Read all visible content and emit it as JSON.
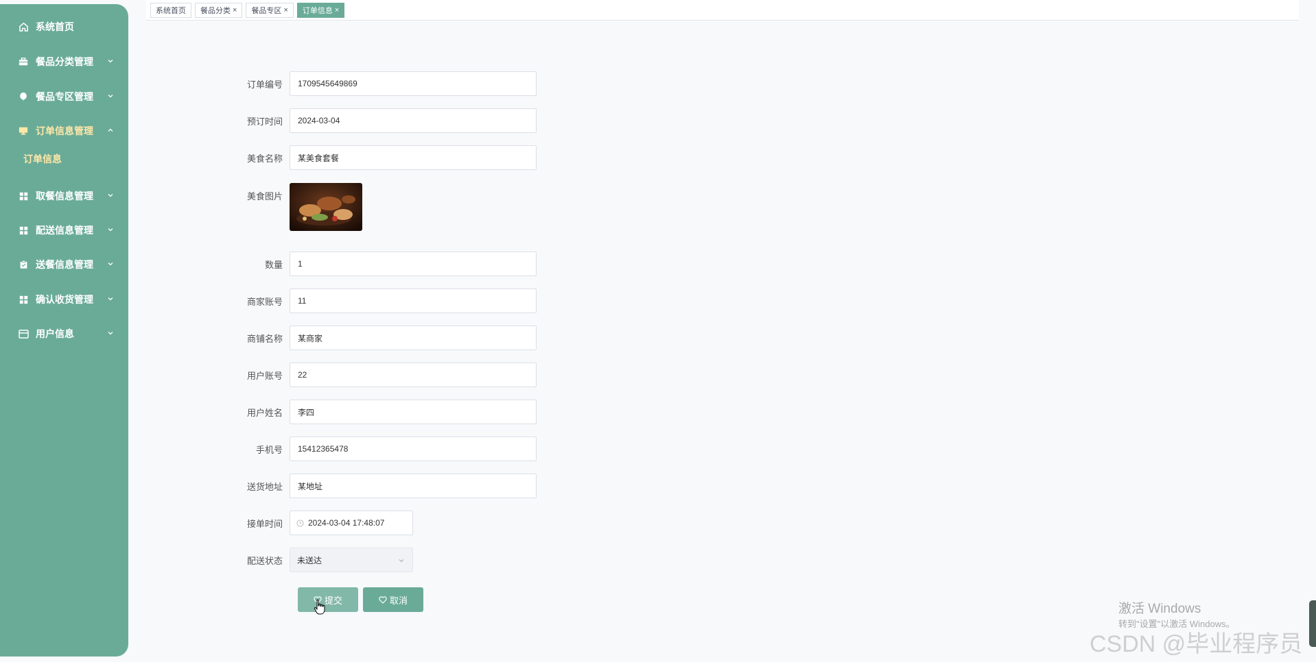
{
  "sidebar": {
    "items": [
      {
        "label": "系统首页",
        "icon": "home-icon",
        "expandable": false
      },
      {
        "label": "餐品分类管理",
        "icon": "briefcase-icon",
        "expandable": true
      },
      {
        "label": "餐品专区管理",
        "icon": "balloon-icon",
        "expandable": true
      },
      {
        "label": "订单信息管理",
        "icon": "monitor-icon",
        "expandable": true,
        "expanded": true
      },
      {
        "label": "取餐信息管理",
        "icon": "grid-icon",
        "expandable": true
      },
      {
        "label": "配送信息管理",
        "icon": "grid-icon",
        "expandable": true
      },
      {
        "label": "送餐信息管理",
        "icon": "clipboard-icon",
        "expandable": true
      },
      {
        "label": "确认收货管理",
        "icon": "grid-icon",
        "expandable": true
      },
      {
        "label": "用户信息",
        "icon": "card-icon",
        "expandable": true
      }
    ],
    "submenu": {
      "label": "订单信息"
    }
  },
  "tabs": [
    {
      "label": "系统首页",
      "closable": false,
      "active": false
    },
    {
      "label": "餐品分类",
      "closable": true,
      "active": false
    },
    {
      "label": "餐品专区",
      "closable": true,
      "active": false
    },
    {
      "label": "订单信息",
      "closable": true,
      "active": true
    }
  ],
  "tab_close_glyph": "×",
  "form": {
    "order_no": {
      "label": "订单编号",
      "value": "1709545649869"
    },
    "book_time": {
      "label": "预订时间",
      "value": "2024-03-04"
    },
    "food_name": {
      "label": "美食名称",
      "value": "某美食套餐"
    },
    "food_image": {
      "label": "美食图片"
    },
    "quantity": {
      "label": "数量",
      "value": "1"
    },
    "merchant_account": {
      "label": "商家账号",
      "value": "11"
    },
    "shop_name": {
      "label": "商铺名称",
      "value": "某商家"
    },
    "user_account": {
      "label": "用户账号",
      "value": "22"
    },
    "user_name": {
      "label": "用户姓名",
      "value": "李四"
    },
    "phone": {
      "label": "手机号",
      "value": "15412365478"
    },
    "address": {
      "label": "送货地址",
      "value": "某地址"
    },
    "accept_time": {
      "label": "接单时间",
      "value": "2024-03-04 17:48:07"
    },
    "delivery_status": {
      "label": "配送状态",
      "value": "未送达"
    }
  },
  "buttons": {
    "submit": "提交",
    "cancel": "取消"
  },
  "watermarks": {
    "windows_title": "激活 Windows",
    "windows_sub": "转到\"设置\"以激活 Windows。",
    "csdn": "CSDN @毕业程序员"
  },
  "colors": {
    "sidebar": "#6aab98",
    "accent": "#6aab98",
    "active_text": "#ffe8a8"
  }
}
